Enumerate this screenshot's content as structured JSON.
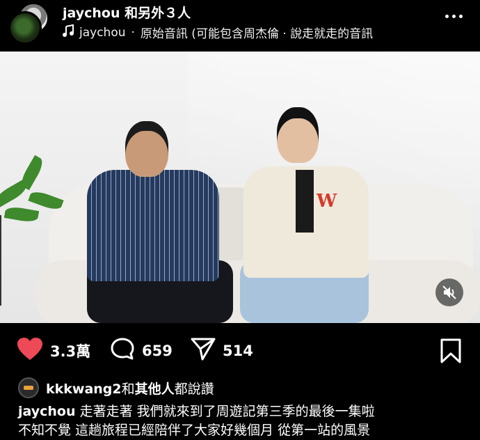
{
  "header": {
    "username": "jaychou",
    "coauthors": "和另外３人",
    "audio_user": "jaychou",
    "audio_sep": "·",
    "audio_text": "原始音訊 (可能包含周杰倫 · 說走就走的音訊"
  },
  "actions": {
    "likes": "3.3萬",
    "comments": "659",
    "shares": "514"
  },
  "liked_by": {
    "user": "kkkwang2",
    "joiner": "和",
    "others": "其他人",
    "suffix": "都說讚"
  },
  "caption": {
    "user": "jaychou",
    "line1": "走著走著 我們就來到了周遊記第三季的最後一集啦",
    "line2": "不知不覺 這趟旅程已經陪伴了大家好幾個月 從第一站的風景"
  },
  "icons": [
    "music-note-icon",
    "more-icon",
    "mute-icon",
    "heart-icon",
    "comment-icon",
    "share-icon",
    "bookmark-icon"
  ],
  "colors": {
    "heart": "#ed4956",
    "background": "#000000",
    "text": "#ffffff"
  }
}
